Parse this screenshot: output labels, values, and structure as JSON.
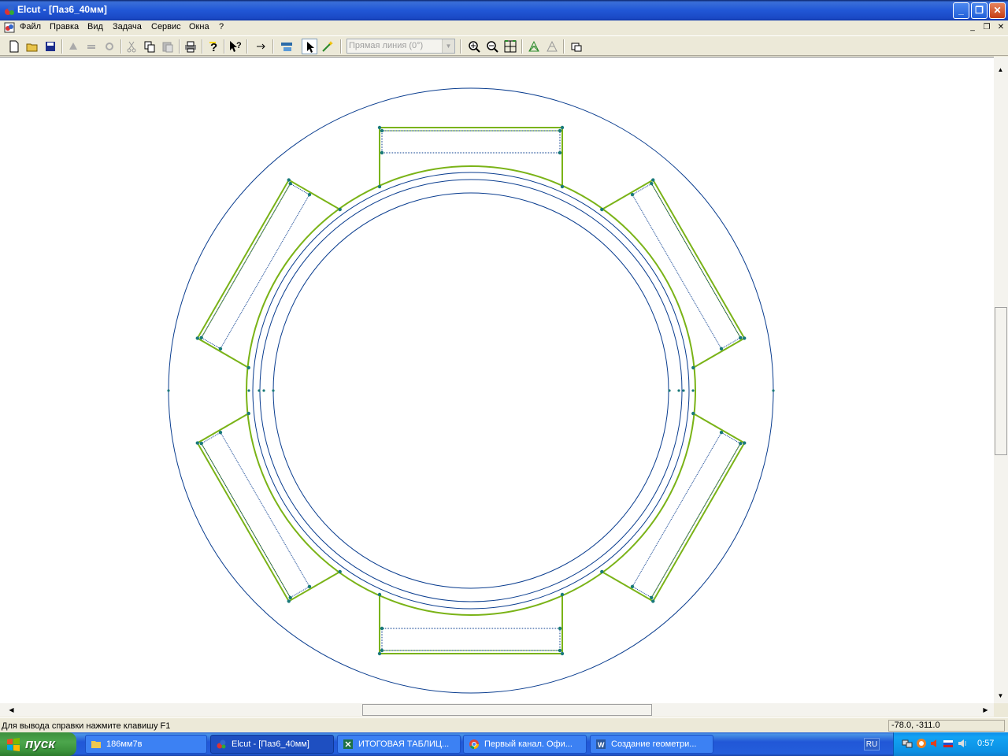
{
  "window": {
    "title": "Elcut - [Паз6_40мм]"
  },
  "menu": {
    "items": [
      "Файл",
      "Правка",
      "Вид",
      "Задача",
      "Сервис",
      "Окна",
      "?"
    ]
  },
  "toolbar": {
    "line_type_value": "Прямая линия (0°)",
    "icons": [
      "new-icon",
      "open-icon",
      "save-icon",
      "tool-a-icon",
      "tool-b-icon",
      "tool-c-icon",
      "cut-icon",
      "copy-icon",
      "paste-icon",
      "print-icon",
      "help-icon",
      "context-help-icon",
      "arrow-icon",
      "view-icon",
      "select-icon",
      "wand-icon",
      "zoom-in-icon",
      "zoom-out-icon",
      "zoom-fit-icon",
      "mesh-icon",
      "mesh-remove-icon",
      "window-icon"
    ]
  },
  "canvas": {
    "colors": {
      "blue_edge": "#0a3d8f",
      "green_edge": "#7ab317",
      "vertex": "#1a7a7a"
    }
  },
  "status": {
    "help_text": "Для вывода справки нажмите клавишу F1",
    "coords": "-78.0, -311.0"
  },
  "taskbar": {
    "start_label": "пуск",
    "tasks": [
      {
        "label": "186мм7в",
        "icon": "folder-icon"
      },
      {
        "label": "Elcut - [Паз6_40мм]",
        "icon": "elcut-icon",
        "active": true
      },
      {
        "label": "ИТОГОВАЯ ТАБЛИЦ...",
        "icon": "excel-icon"
      },
      {
        "label": "Первый канал. Офи...",
        "icon": "chrome-icon"
      },
      {
        "label": "Создание геометри...",
        "icon": "word-icon"
      }
    ],
    "language": "RU",
    "clock": "0:57"
  }
}
